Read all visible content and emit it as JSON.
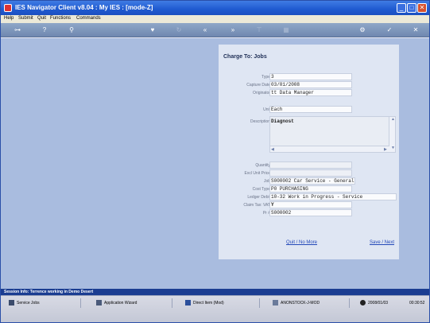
{
  "window": {
    "title": "IES Navigator Client v8.04 : My IES :      [mode-Z]"
  },
  "menu": [
    "Help",
    "Submit",
    "Quit",
    "Functions",
    "Commands"
  ],
  "form": {
    "title": "Charge To: Jobs",
    "fields": {
      "type": {
        "label": "Type",
        "value": "3"
      },
      "capture_date": {
        "label": "Capture Date",
        "value": "03/01/2008"
      },
      "originator": {
        "label": "Originator",
        "value": "tt Data Manager"
      },
      "unit": {
        "label": "Unit",
        "value": "Each"
      },
      "description": {
        "label": "Description",
        "value": "Diagnost"
      },
      "quantity": {
        "label": "Quantity",
        "value": ""
      },
      "excl_unit_price": {
        "label": "Excl Unit Price",
        "value": ""
      },
      "job": {
        "label": "Job",
        "value": "S000002 Car Service - General"
      },
      "cost_type": {
        "label": "Cost Type",
        "value": "P0 PURCHASING"
      },
      "ledger_debit": {
        "label": "Ledger Debit",
        "value": "10-32 Work in Progress - Service"
      },
      "claim_tax_vat": {
        "label": "Claim Tax: VAT",
        "value": "Y"
      },
      "pr_number": {
        "label": "Pr #",
        "value": "S000002"
      }
    },
    "links": {
      "quit": "Quit / No More",
      "save": "Save / Next"
    }
  },
  "status": {
    "session_info": "Session Info: Terrence working in Demo Desert"
  },
  "taskbar": {
    "items": [
      "Service Jobs",
      "Application Wizard",
      "Direct Item (Mod)",
      "ANONSTOCK-J-MOD"
    ],
    "date": "2008/01/03",
    "time": "00:30:52"
  },
  "colors": {
    "titlebar": "#1f5ad0",
    "workspace": "#a9bcdf",
    "link": "#2248b8",
    "status": "#1b3d91"
  }
}
